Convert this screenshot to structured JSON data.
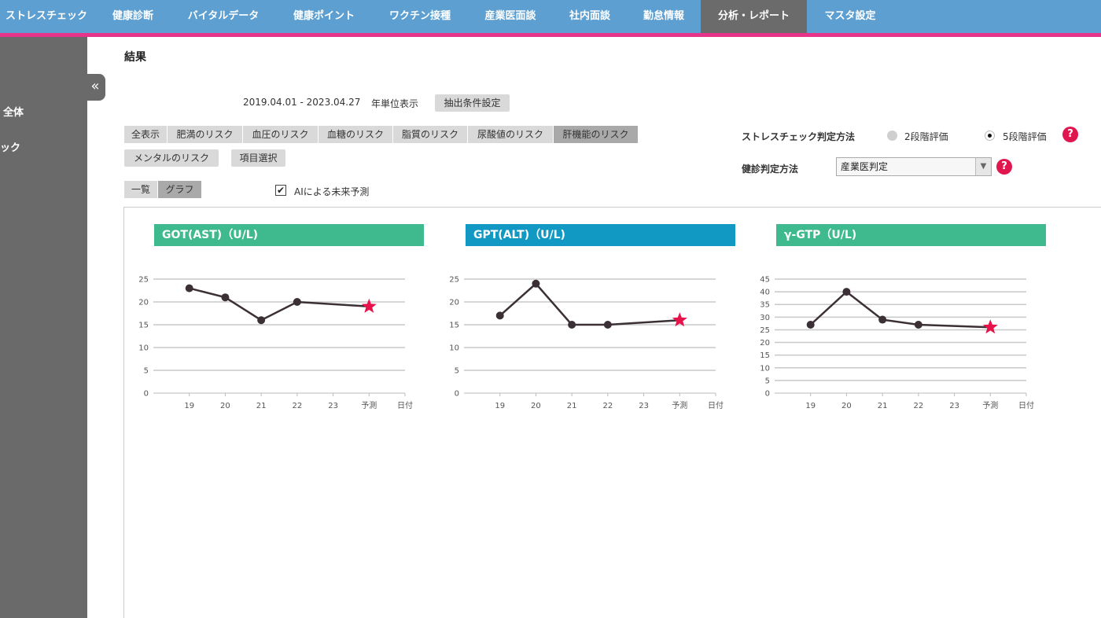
{
  "nav": {
    "items": [
      "ストレスチェック",
      "健康診断",
      "バイタルデータ",
      "健康ポイント",
      "ワクチン接種",
      "産業医面談",
      "社内面談",
      "勤怠情報",
      "分析・レポート",
      "マスタ設定"
    ],
    "active": "分析・レポート"
  },
  "sidebar": {
    "collapse_icon": "«",
    "items": [
      "全体",
      "ック"
    ]
  },
  "page": {
    "title": "結果"
  },
  "filter": {
    "date_range": "2019.04.01 - 2023.04.27",
    "unit": "年単位表示",
    "extract_button": "抽出条件設定"
  },
  "risk_tabs": [
    "全表示",
    "肥満のリスク",
    "血圧のリスク",
    "血糖のリスク",
    "脂質のリスク",
    "尿酸値のリスク",
    "肝機能のリスク"
  ],
  "risk_tabs_row2": {
    "mental": "メンタルのリスク",
    "item_select": "項目選択"
  },
  "active_risk_tab": "肝機能のリスク",
  "view_toggle": {
    "list": "一覧",
    "graph": "グラフ",
    "active": "グラフ"
  },
  "ai_prediction": {
    "label": "AIによる未来予測",
    "checked": true,
    "check_mark": "✔"
  },
  "stress_method": {
    "label": "ストレスチェック判定方法",
    "options": [
      "2段階評価",
      "5段階評価"
    ],
    "selected": "5段階評価"
  },
  "exam_method": {
    "label": "健診判定方法",
    "value": "産業医判定",
    "arrow": "▼"
  },
  "help_icon": "?",
  "colors": {
    "nav": "#5c9fd0",
    "accent_line": "#e8338a",
    "green": "#3fba8e",
    "blue": "#1199c4",
    "line": "#3b3035",
    "star": "#e8124a"
  },
  "chart_data": [
    {
      "type": "line",
      "title": "GOT(AST)（U/L)",
      "categories": [
        "19",
        "20",
        "21",
        "22",
        "23",
        "予測"
      ],
      "xlabel": "日付",
      "values": [
        23,
        21,
        16,
        20,
        null,
        19
      ],
      "predicted_index": 5,
      "yticks": [
        "0",
        "5",
        "10",
        "15",
        "20",
        "25"
      ],
      "ylim": [
        0,
        25
      ],
      "header_color": "#3fba8e",
      "grid": true
    },
    {
      "type": "line",
      "title": "GPT(ALT)（U/L)",
      "categories": [
        "19",
        "20",
        "21",
        "22",
        "23",
        "予測"
      ],
      "xlabel": "日付",
      "values": [
        17,
        24,
        15,
        15,
        null,
        16
      ],
      "predicted_index": 5,
      "yticks": [
        "0",
        "5",
        "10",
        "15",
        "20",
        "25"
      ],
      "ylim": [
        0,
        25
      ],
      "header_color": "#1199c4",
      "grid": true
    },
    {
      "type": "line",
      "title": "γ-GTP（U/L)",
      "categories": [
        "19",
        "20",
        "21",
        "22",
        "23",
        "予測"
      ],
      "xlabel": "日付",
      "values": [
        27,
        40,
        29,
        27,
        null,
        26
      ],
      "predicted_index": 5,
      "yticks": [
        "0",
        "5",
        "10",
        "15",
        "20",
        "25",
        "30",
        "35",
        "40",
        "45"
      ],
      "ylim": [
        0,
        45
      ],
      "header_color": "#3fba8e",
      "grid": true
    }
  ]
}
